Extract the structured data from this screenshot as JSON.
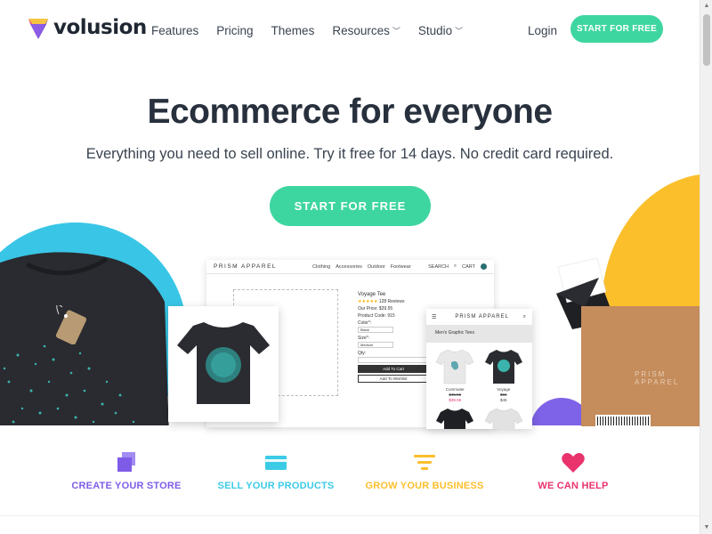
{
  "header": {
    "logo_text": "volusion",
    "nav": [
      {
        "label": "Features",
        "dropdown": false
      },
      {
        "label": "Pricing",
        "dropdown": false
      },
      {
        "label": "Themes",
        "dropdown": false
      },
      {
        "label": "Resources",
        "dropdown": true
      },
      {
        "label": "Studio",
        "dropdown": true
      }
    ],
    "login_label": "Login",
    "cta_label": "START FOR FREE"
  },
  "hero": {
    "title": "Ecommerce for everyone",
    "subtitle": "Everything you need to sell online. Try it free for 14 days. No credit card required.",
    "cta_label": "START FOR FREE"
  },
  "mockup": {
    "desktop": {
      "brand": "PRISM APPAREL",
      "links": [
        "Clothing",
        "Accessories",
        "Outdoor",
        "Footwear"
      ],
      "search_label": "SEARCH",
      "cart_label": "CART",
      "product_name": "Voyage Tee",
      "stars": "★★★★★",
      "reviews": "128 Reviews",
      "price_line": "Our Price: $39.55",
      "product_code": "Product Code: 915",
      "color_label": "Color*:",
      "color_value": "Black",
      "size_label": "Size*:",
      "size_value": "Medium",
      "qty_label": "Qty:",
      "add_to_cart": "Add To Cart",
      "add_to_wishlist": "Add To Wishlist"
    },
    "mobile": {
      "brand": "PRISM APPAREL",
      "banner": "Men's Graphic Tees",
      "products": [
        {
          "name": "Commuter",
          "old_price": "$45.55",
          "price": "$39.55"
        },
        {
          "name": "Voyage",
          "old_price": "$58",
          "price": "$45"
        }
      ]
    },
    "box_label": "PRISM APPAREL"
  },
  "features": [
    {
      "label": "CREATE YOUR STORE",
      "icon": "layers-icon",
      "color": "#7e5ce8"
    },
    {
      "label": "SELL YOUR PRODUCTS",
      "icon": "credit-card-icon",
      "color": "#3ccbe6"
    },
    {
      "label": "GROW YOUR BUSINESS",
      "icon": "funnel-icon",
      "color": "#fbbf2c"
    },
    {
      "label": "WE CAN HELP",
      "icon": "heart-icon",
      "color": "#e8336d"
    }
  ],
  "colors": {
    "accent": "#3ed6a0",
    "blue": "#39c6e6",
    "yellow": "#fbbf2c",
    "purple": "#7e62e8",
    "pink": "#e8336d"
  }
}
